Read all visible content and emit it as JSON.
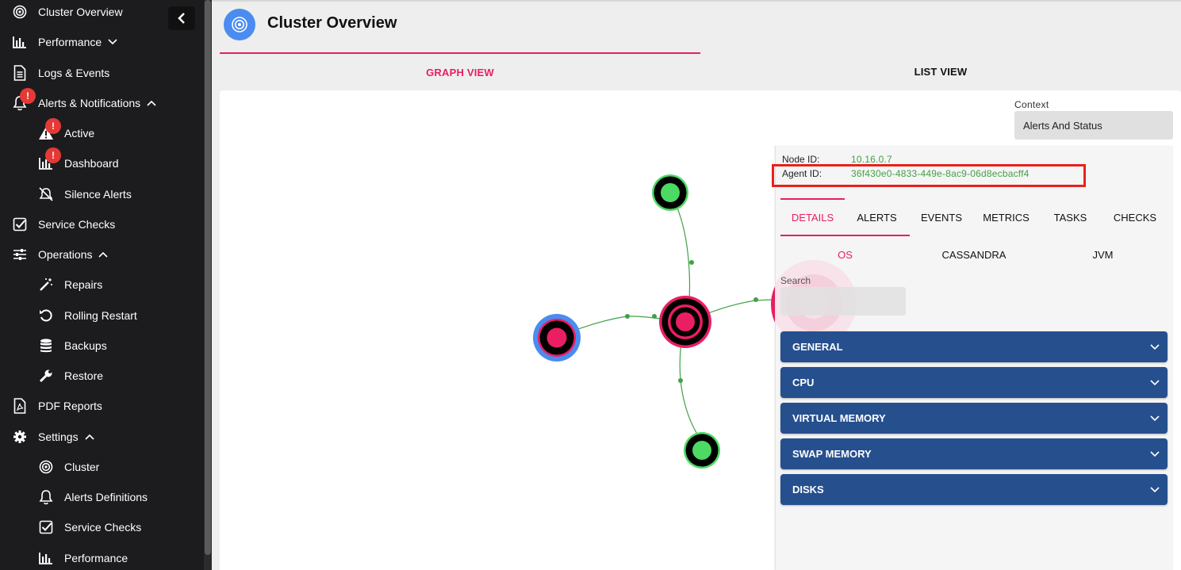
{
  "sidebar": {
    "items": [
      {
        "label": "Cluster Overview",
        "icon": "target-icon"
      },
      {
        "label": "Performance",
        "icon": "bar-chart-icon"
      },
      {
        "label": "Logs & Events",
        "icon": "document-icon"
      },
      {
        "label": "Alerts & Notifications",
        "icon": "bell-icon",
        "badge": "!"
      },
      {
        "label": "Active",
        "icon": "warning-icon",
        "badge": "!"
      },
      {
        "label": "Dashboard",
        "icon": "bar-chart-icon",
        "badge": "!"
      },
      {
        "label": "Silence Alerts",
        "icon": "bell-off-icon"
      },
      {
        "label": "Service Checks",
        "icon": "checkbox-icon"
      },
      {
        "label": "Operations",
        "icon": "sliders-icon"
      },
      {
        "label": "Repairs",
        "icon": "wand-icon"
      },
      {
        "label": "Rolling Restart",
        "icon": "restart-icon"
      },
      {
        "label": "Backups",
        "icon": "database-icon"
      },
      {
        "label": "Restore",
        "icon": "wrench-icon"
      },
      {
        "label": "PDF Reports",
        "icon": "pdf-icon"
      },
      {
        "label": "Settings",
        "icon": "gear-icon"
      },
      {
        "label": "Cluster",
        "icon": "target-icon"
      },
      {
        "label": "Alerts Definitions",
        "icon": "bell-icon"
      },
      {
        "label": "Service Checks",
        "icon": "checkbox-icon"
      },
      {
        "label": "Performance",
        "icon": "bar-chart-icon"
      }
    ]
  },
  "header": {
    "title": "Cluster Overview",
    "tabs": [
      {
        "label": "GRAPH VIEW",
        "active": true
      },
      {
        "label": "LIST VIEW",
        "active": false
      }
    ]
  },
  "context": {
    "label": "Context",
    "value": "Alerts And Status"
  },
  "details": {
    "node_id_label": "Node ID:",
    "node_id": "10.16.0.7",
    "agent_id_label": "Agent ID:",
    "agent_id": "36f430e0-4833-449e-8ac9-06d8ecbacff4",
    "tabs": [
      "DETAILS",
      "ALERTS",
      "EVENTS",
      "METRICS",
      "TASKS",
      "CHECKS"
    ],
    "subtabs": [
      "OS",
      "CASSANDRA",
      "JVM"
    ],
    "search_label": "Search",
    "search_value": "",
    "sections": [
      "GENERAL",
      "CPU",
      "VIRTUAL MEMORY",
      "SWAP MEMORY",
      "DISKS"
    ]
  },
  "colors": {
    "accent": "#e91e63",
    "node_ok": "#4cd964",
    "node_alert": "#e91e63",
    "selected_ring": "#4a8cf0",
    "accordion": "#264f8e",
    "id_value": "#43a047"
  }
}
